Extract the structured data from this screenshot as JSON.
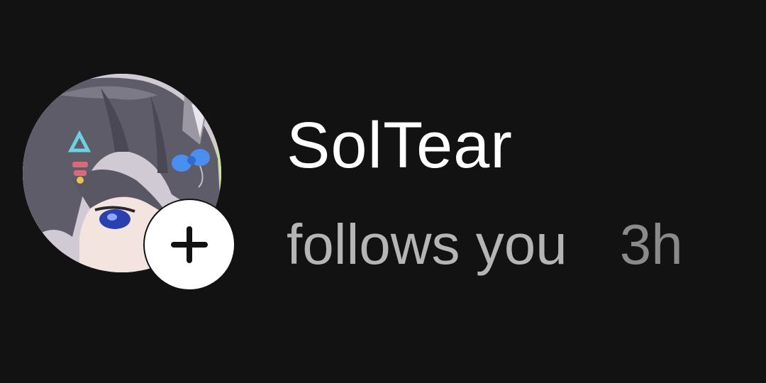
{
  "notification": {
    "username": "SolTear",
    "activity": "follows you",
    "time": "3h"
  },
  "icons": {
    "follow_button": "plus-icon"
  },
  "colors": {
    "background": "#121212",
    "username": "#ffffff",
    "activity": "#b5b5b5",
    "time": "#8a8a8a",
    "follow_button_bg": "#ffffff",
    "plus_icon": "#111111"
  }
}
